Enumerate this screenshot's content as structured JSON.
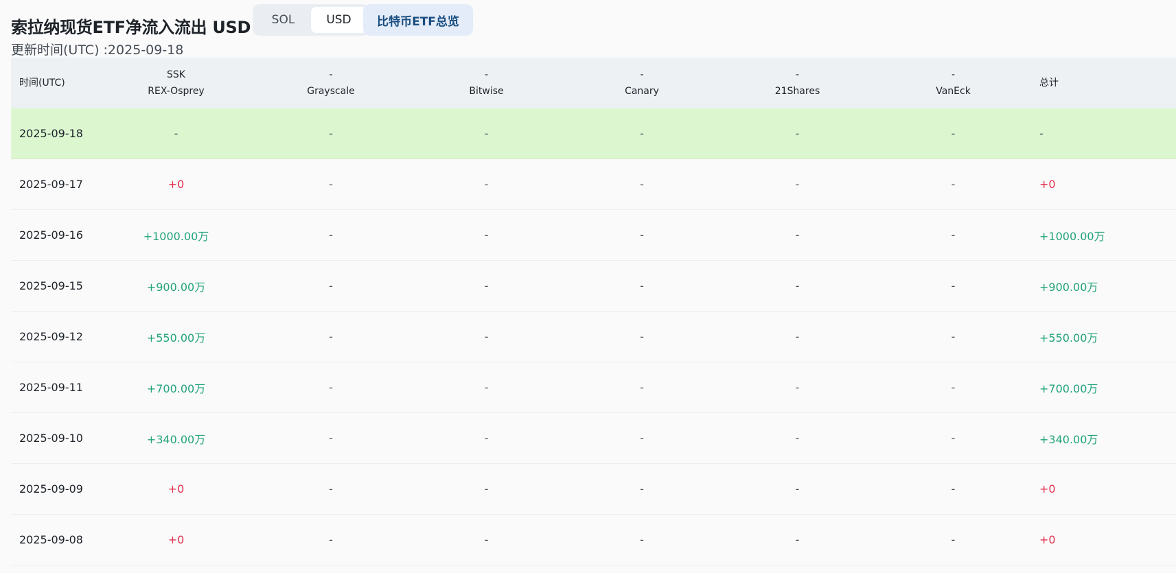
{
  "header": {
    "title": "索拉纳现货ETF净流入流出 USD",
    "toggle": {
      "sol": "SOL",
      "usd": "USD",
      "active": "USD"
    },
    "overview_button": "比特币ETF总览",
    "updated": "更新时间(UTC) :2025-09-18"
  },
  "table": {
    "columns": [
      {
        "ticker": "时间(UTC)",
        "issuer": ""
      },
      {
        "ticker": "SSK",
        "issuer": "REX-Osprey"
      },
      {
        "ticker": "-",
        "issuer": "Grayscale"
      },
      {
        "ticker": "-",
        "issuer": "Bitwise"
      },
      {
        "ticker": "-",
        "issuer": "Canary"
      },
      {
        "ticker": "-",
        "issuer": "21Shares"
      },
      {
        "ticker": "-",
        "issuer": "VanEck"
      },
      {
        "ticker": "总计",
        "issuer": ""
      }
    ],
    "rows": [
      {
        "date": "2025-09-18",
        "ssk": "-",
        "grayscale": "-",
        "bitwise": "-",
        "canary": "-",
        "shares21": "-",
        "vaneck": "-",
        "total": "-",
        "highlight": true
      },
      {
        "date": "2025-09-17",
        "ssk": "+0",
        "grayscale": "-",
        "bitwise": "-",
        "canary": "-",
        "shares21": "-",
        "vaneck": "-",
        "total": "+0"
      },
      {
        "date": "2025-09-16",
        "ssk": "+1000.00万",
        "grayscale": "-",
        "bitwise": "-",
        "canary": "-",
        "shares21": "-",
        "vaneck": "-",
        "total": "+1000.00万"
      },
      {
        "date": "2025-09-15",
        "ssk": "+900.00万",
        "grayscale": "-",
        "bitwise": "-",
        "canary": "-",
        "shares21": "-",
        "vaneck": "-",
        "total": "+900.00万"
      },
      {
        "date": "2025-09-12",
        "ssk": "+550.00万",
        "grayscale": "-",
        "bitwise": "-",
        "canary": "-",
        "shares21": "-",
        "vaneck": "-",
        "total": "+550.00万"
      },
      {
        "date": "2025-09-11",
        "ssk": "+700.00万",
        "grayscale": "-",
        "bitwise": "-",
        "canary": "-",
        "shares21": "-",
        "vaneck": "-",
        "total": "+700.00万"
      },
      {
        "date": "2025-09-10",
        "ssk": "+340.00万",
        "grayscale": "-",
        "bitwise": "-",
        "canary": "-",
        "shares21": "-",
        "vaneck": "-",
        "total": "+340.00万"
      },
      {
        "date": "2025-09-09",
        "ssk": "+0",
        "grayscale": "-",
        "bitwise": "-",
        "canary": "-",
        "shares21": "-",
        "vaneck": "-",
        "total": "+0"
      },
      {
        "date": "2025-09-08",
        "ssk": "+0",
        "grayscale": "-",
        "bitwise": "-",
        "canary": "-",
        "shares21": "-",
        "vaneck": "-",
        "total": "+0"
      }
    ]
  },
  "colors": {
    "positive": "#22a37b",
    "zero": "#e0304e",
    "highlight_row": "#dcf7d0",
    "header_bg": "#eef1f4",
    "overview_bg": "#e3ecf8"
  }
}
